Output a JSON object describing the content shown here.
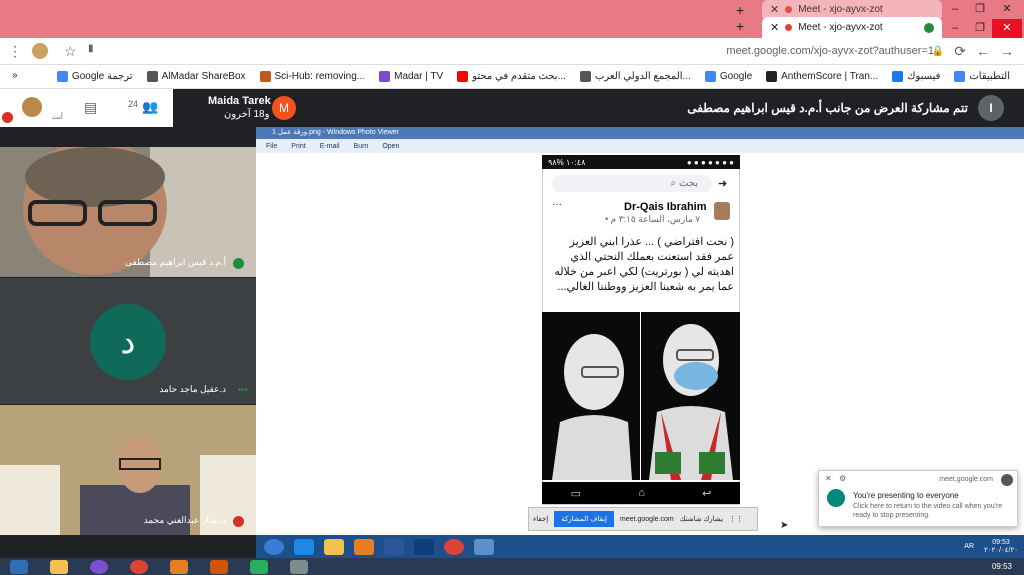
{
  "tabs": [
    {
      "title": "Meet - xjo-ayvx-zot"
    },
    {
      "title": "Meet - xjo-ayvx-zot"
    }
  ],
  "window_controls": {
    "minimize": "–",
    "restore": "❐",
    "close": "✕"
  },
  "omnibox": {
    "url": "meet.google.com/xjo-ayvx-zot?authuser=1"
  },
  "bookmarks": [
    {
      "label": "التطبيقات",
      "color": "#4285f4"
    },
    {
      "label": "فيسبوك",
      "color": "#1877f2"
    },
    {
      "label": "AnthemScore | Tran...",
      "color": "#222222"
    },
    {
      "label": "Google",
      "color": "#4285f4"
    },
    {
      "label": "المجمع الدولي العرب...",
      "color": "#555555"
    },
    {
      "label": "بحث متقدم في محتو...",
      "color": "#ff0000"
    },
    {
      "label": "Madar | TV",
      "color": "#7a4bd1"
    },
    {
      "label": "Sci-Hub: removing...",
      "color": "#c05a1a"
    },
    {
      "label": "AlMadar ShareBox",
      "color": "#555555"
    },
    {
      "label": "Google ترجمة",
      "color": "#4285f4"
    }
  ],
  "meet_header": {
    "participant_count": "24",
    "presenter_name": "Maida Tarek",
    "presenter_others": "و18 آخرون",
    "presenter_initial": "M",
    "presenting_banner": "تتم مشاركة العرض من جانب أ.م.د قيس ابراهيم مصطفى",
    "banner_initial": "I",
    "self_label": "أنت"
  },
  "tiles": [
    {
      "name": "أ.م.د قيس ابراهيم مصطفى"
    },
    {
      "name": "د.عقيل ماجد حامد",
      "initial": "د"
    },
    {
      "name": "د.بشار عبدالغني محمد"
    }
  ],
  "photo_viewer": {
    "title": "ورقة عمل 1.png - Windows Photo Viewer",
    "menu": [
      "File",
      "Print",
      "E-mail",
      "Burn",
      "Open"
    ]
  },
  "phone": {
    "status_time": "١٠:٤٨",
    "status_battery": "%٩٨",
    "search_placeholder": "بحث",
    "author": "Dr-Qais Ibrahim",
    "post_time": "٧ مارس، الساعة ٣:١٥ م •",
    "post_text": "( نحت افتراضي ) ... عذرا ابني العزيز عمر فقد استعنت بعملك النحتي الذي اهديته لي ( بورتريت) لكي اعبر من خلاله عما يمر به شعبنا العزيز ووطننا الغالي..."
  },
  "share_bar": {
    "site": "meet.google.com",
    "message": "يشارك شاشتك",
    "stop": "إيقاف المشاركة",
    "hide": "إخفاء"
  },
  "toast": {
    "source": "meet.google.com",
    "title": "You're presenting to everyone",
    "body": "Click here to return to the video call when you're ready to stop presenting."
  },
  "taskbar": {
    "lang": "AR",
    "time": "09:53",
    "date": "٢٠٢٠/٠٤/٢٠",
    "time2": "09:53"
  }
}
